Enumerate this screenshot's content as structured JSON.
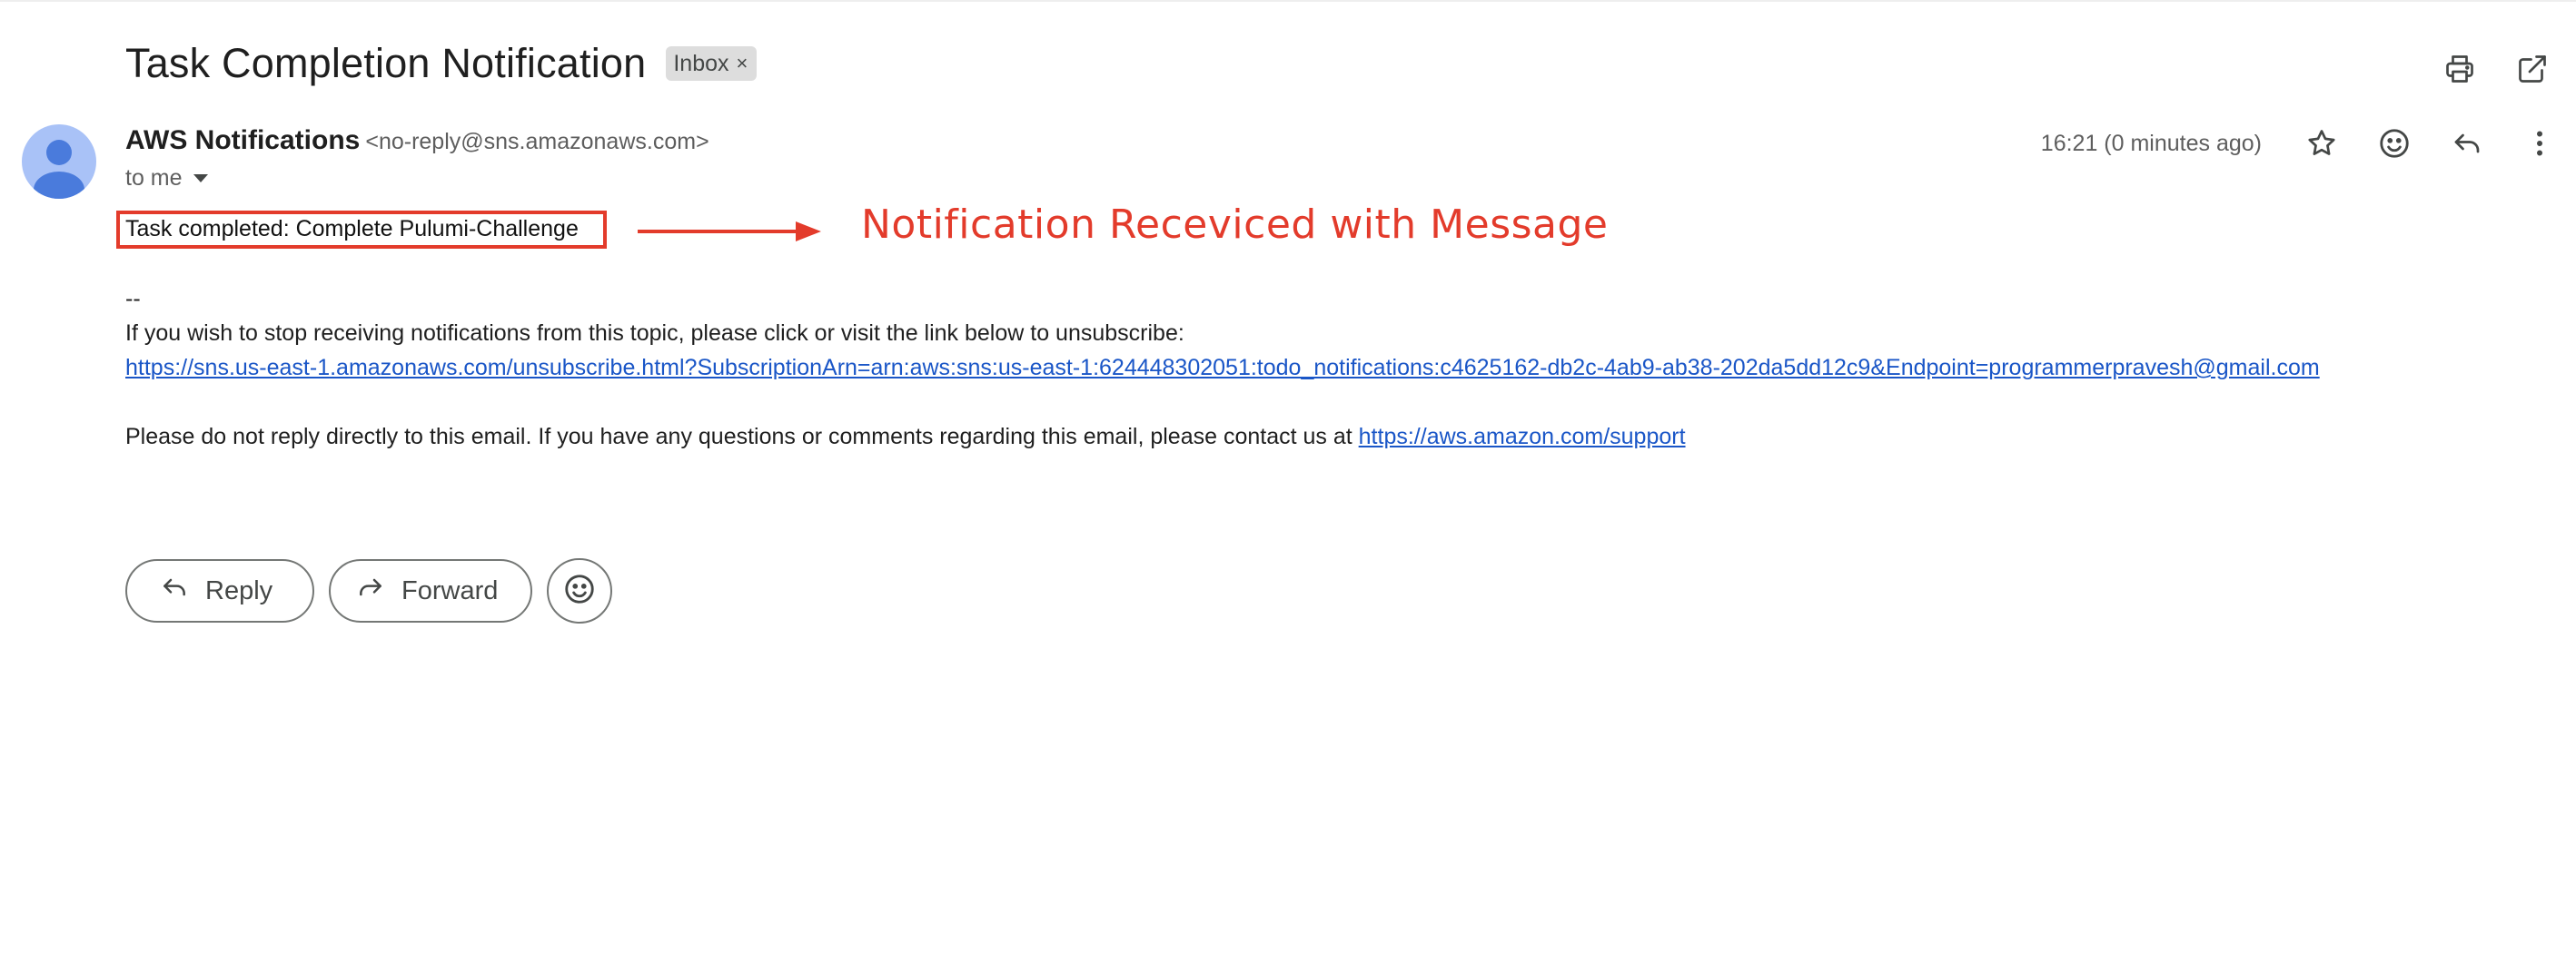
{
  "email": {
    "subject": "Task Completion Notification",
    "label": "Inbox",
    "label_remove": "×",
    "sender_name": "AWS Notifications",
    "sender_email": "<no-reply@sns.amazonaws.com>",
    "recipient": "to me",
    "timestamp": "16:21 (0 minutes ago)",
    "body": {
      "message": "Task completed: Complete Pulumi-Challenge",
      "separator": "--",
      "unsubscribe_text": "If you wish to stop receiving notifications from this topic, please click or visit the link below to unsubscribe:",
      "unsubscribe_link": "https://sns.us-east-1.amazonaws.com/unsubscribe.html?SubscriptionArn=arn:aws:sns:us-east-1:624448302051:todo_notifications:c4625162-db2c-4ab9-ab38-202da5dd12c9&Endpoint=programmerpravesh@gmail.com",
      "footer_text": "Please do not reply directly to this email. If you have any questions or comments regarding this email, please contact us at ",
      "support_link": "https://aws.amazon.com/support"
    }
  },
  "annotation": {
    "text": "Notification Receviced with Message",
    "color": "#e33b2b"
  },
  "actions": {
    "reply_label": "Reply",
    "forward_label": "Forward"
  },
  "icons": {
    "top": [
      "print-icon",
      "open-in-new-window-icon"
    ],
    "meta": [
      "star-icon",
      "emoji-reaction-icon",
      "reply-icon",
      "more-vert-icon"
    ],
    "bottom": [
      "reply-icon",
      "forward-icon",
      "emoji-reaction-icon"
    ]
  },
  "colors": {
    "avatar": "#a9c2f7",
    "avatar_figure": "#4a7bdc",
    "link": "#1a56c7",
    "chip": "#dddddd"
  }
}
